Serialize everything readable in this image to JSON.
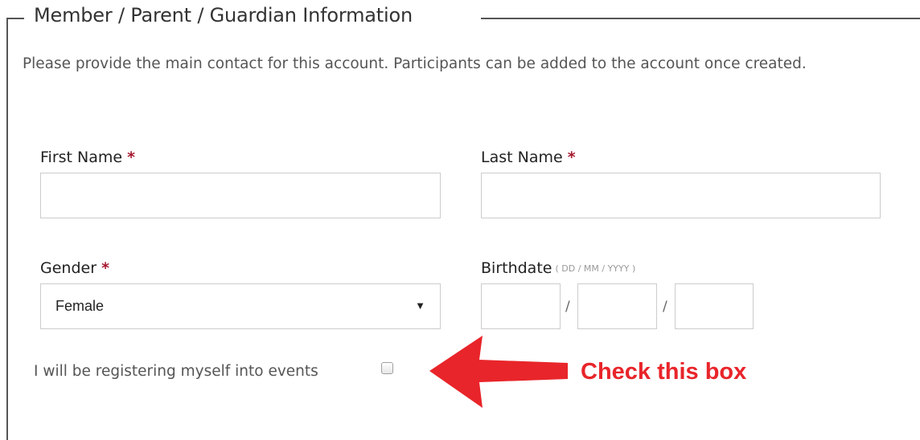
{
  "section": {
    "legend": "Member / Parent / Guardian Information",
    "intro": "Please provide the main contact for this account. Participants can be added to the account once created."
  },
  "form": {
    "first_name": {
      "label": "First Name",
      "required_mark": "*",
      "value": ""
    },
    "last_name": {
      "label": "Last Name",
      "required_mark": "*",
      "value": ""
    },
    "gender": {
      "label": "Gender",
      "required_mark": "*",
      "selected": "Female"
    },
    "birthdate": {
      "label": "Birthdate",
      "format_hint": "( DD / MM / YYYY )",
      "separator": "/",
      "day": "",
      "month": "",
      "year": ""
    },
    "self_register": {
      "label": "I will be registering myself into events",
      "checked": false
    }
  },
  "annotation": {
    "text": "Check this box",
    "color": "#e8252a",
    "icon": "red-arrow-left-icon"
  },
  "colors": {
    "required": "#a6192e",
    "input_border": "#cccccc"
  }
}
